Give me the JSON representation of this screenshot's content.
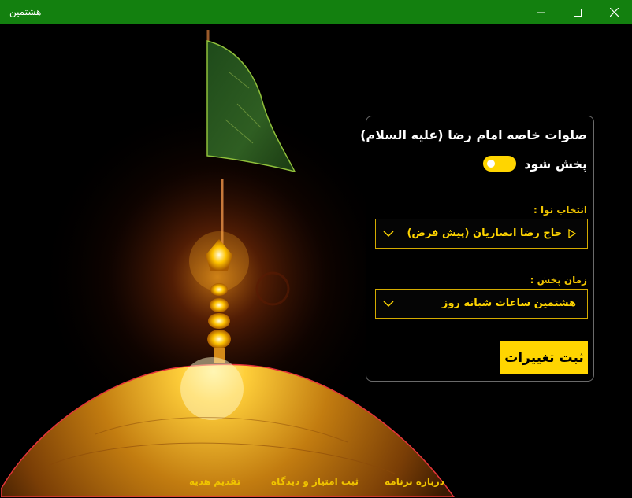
{
  "window": {
    "title": "هشتمین",
    "minimize_icon": "minimize-icon",
    "maximize_icon": "maximize-icon",
    "close_icon": "close-icon"
  },
  "panel": {
    "heading": "صلوات خاصه امام رضا (علیه السلام)",
    "toggle": {
      "label": "پخش شود",
      "on": true
    },
    "voice": {
      "label": "انتخاب نوا :",
      "selected": "حاج رضا انصاریان (پیش فرض)",
      "play_icon": "play-icon"
    },
    "time": {
      "label": "زمان پخش :",
      "selected": "هشتمین ساعات شبانه روز"
    },
    "save_label": "ثبت تغییرات"
  },
  "footer": {
    "about": "درباره برنامه",
    "rate": "ثبت امتیاز و دیدگاه",
    "gift": "تقدیم هدیه"
  },
  "colors": {
    "titlebar": "#13800f",
    "accent": "#ffd500",
    "accent_text": "#f0c400"
  }
}
